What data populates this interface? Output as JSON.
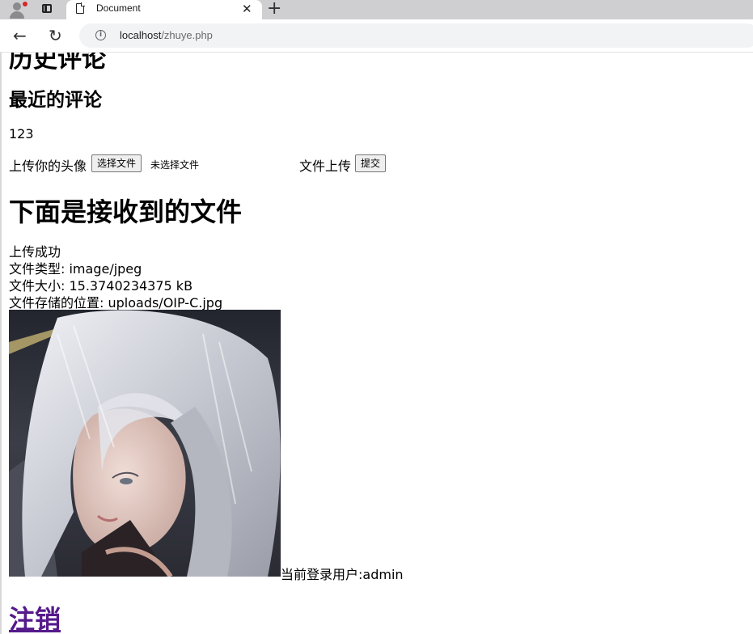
{
  "browser": {
    "tab_title": "Document",
    "tab_close": "✕",
    "new_tab": "+",
    "url_host": "localhost",
    "url_path": "/zhuye.php",
    "info_glyph": "i",
    "back_glyph": "←",
    "reload_glyph": "↻"
  },
  "page": {
    "history_heading": "历史评论",
    "recent_heading": "最近的评论",
    "comment_text": "123",
    "upload": {
      "avatar_label": "上传你的头像",
      "choose_button": "选择文件",
      "no_file_text": "未选择文件",
      "file_upload_label": "文件上传",
      "submit_button": "提交"
    },
    "files_heading": "下面是接收到的文件",
    "upload_info": {
      "status": "上传成功",
      "file_type": "文件类型: image/jpeg",
      "file_size": "文件大小: 15.3740234375 kB",
      "file_location": "文件存储的位置: uploads/OIP-C.jpg"
    },
    "current_user": "当前登录用户:admin",
    "logout_link": "注销"
  },
  "colors": {
    "tabstrip_bg": "#cfcfd1",
    "link_visited": "#551a8b",
    "omnibox_bg": "#f1f3f4"
  }
}
